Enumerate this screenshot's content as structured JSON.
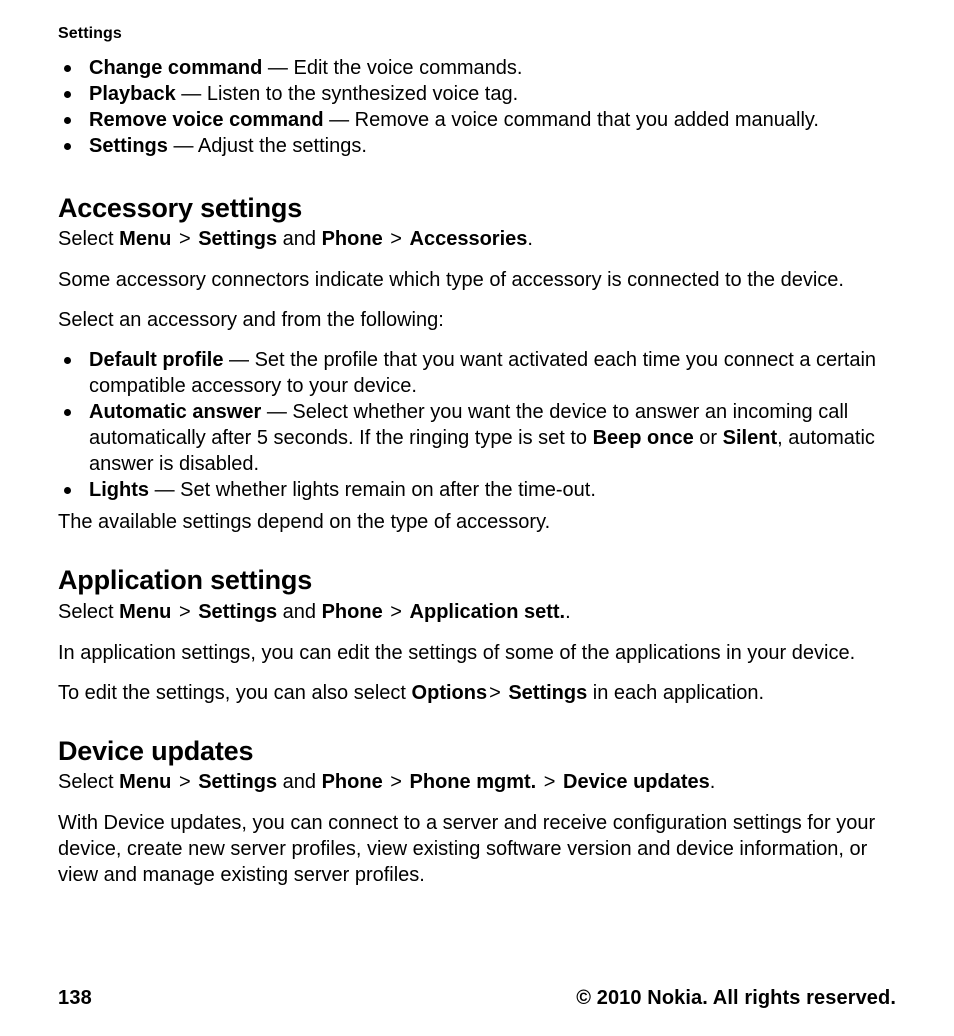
{
  "document": {
    "running_head": "Settings",
    "page_number": "138",
    "copyright": "© 2010 Nokia. All rights reserved."
  },
  "voice_command_bullets": [
    {
      "term": "Change command",
      "dash": "—",
      "description": "Edit the voice commands."
    },
    {
      "term": "Playback",
      "dash": "—",
      "description": "Listen to the synthesized voice tag."
    },
    {
      "term": "Remove voice command",
      "dash": "—",
      "description": "Remove a voice command that you added manually."
    },
    {
      "term": "Settings",
      "dash": "—",
      "description": "Adjust the settings."
    }
  ],
  "accessory_settings": {
    "heading": "Accessory settings",
    "select_path": {
      "select": "Select",
      "item1": "Menu",
      "sep1": ">",
      "item2": "Settings",
      "and": "and",
      "item3": "Phone",
      "sep2": ">",
      "item4": "Accessories",
      "end": "."
    },
    "intro": "Some accessory connectors indicate which type of accessory is connected to the device.",
    "lead_in": "Select an accessory and from the following:",
    "bullets": [
      {
        "term": "Default profile",
        "dash": "—",
        "description": "Set the profile that you want activated each time you connect a certain compatible accessory to your device."
      },
      {
        "term": "Automatic answer",
        "dash": "—",
        "desc_part1": "Select whether you want the device to answer an incoming call automatically after 5 seconds. If the ringing type is set to ",
        "bold1": "Beep once",
        "mid": " or ",
        "bold2": "Silent",
        "desc_part2": ", automatic answer is disabled."
      },
      {
        "term": "Lights",
        "dash": "—",
        "description": "Set whether lights remain on after the time-out."
      }
    ],
    "outro": "The available settings depend on the type of accessory."
  },
  "application_settings": {
    "heading": "Application settings",
    "select_path": {
      "select": "Select",
      "item1": "Menu",
      "sep1": ">",
      "item2": "Settings",
      "and": "and",
      "item3": "Phone",
      "sep2": ">",
      "item4": "Application sett.",
      "end": "."
    },
    "para1": "In application settings, you can edit the settings of some of the applications in your device.",
    "para2": {
      "before": "To edit the settings, you can also select ",
      "bold1": "Options",
      "sep": ">",
      "bold2": "Settings",
      "after": " in each application."
    }
  },
  "device_updates": {
    "heading": "Device updates",
    "select_path": {
      "select": "Select",
      "item1": "Menu",
      "sep1": ">",
      "item2": "Settings",
      "and": "and",
      "item3": "Phone",
      "sep2": ">",
      "item4": "Phone mgmt.",
      "sep3": ">",
      "item5": "Device updates",
      "end": "."
    },
    "para1": "With Device updates, you can connect to a server and receive configuration settings for your device, create new server profiles, view existing software version and device information, or view and manage existing server profiles."
  }
}
